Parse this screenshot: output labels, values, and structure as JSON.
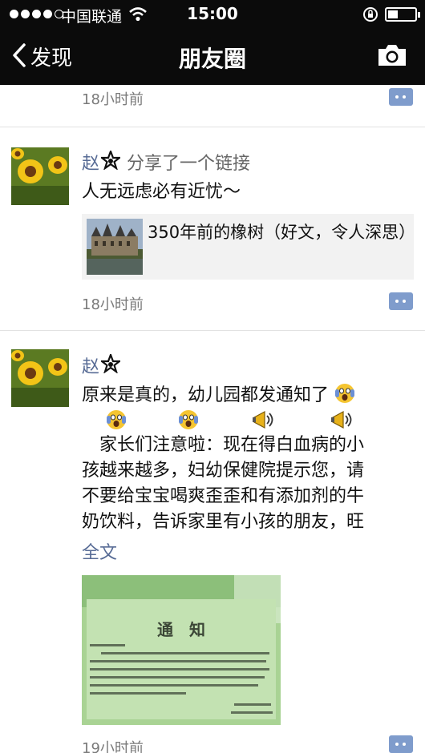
{
  "status_bar": {
    "carrier": "中国联通",
    "time": "15:00"
  },
  "nav": {
    "back_label": "发现",
    "title": "朋友圈"
  },
  "feed": {
    "top_post_time": "18小时前",
    "posts": [
      {
        "author": "赵",
        "action": "分享了一个链接",
        "text": "人无远虑必有近忧～",
        "link_title": "350年前的橡树（好文，令人深思）",
        "time": "18小时前"
      },
      {
        "author": "赵",
        "text_line1": "原来是真的，幼儿园都发通知了",
        "text_line3": "　家长们注意啦：现在得白血病的小",
        "text_line4": "孩越来越多，妇幼保健院提示您，请",
        "text_line5": "不要给宝宝喝爽歪歪和有添加剂的牛",
        "text_line6": "奶饮料，告诉家里有小孩的朋友，旺",
        "full_text_link": "全文",
        "image_heading": "通　知",
        "time": "19小时前"
      }
    ]
  },
  "colors": {
    "nav_background": "#0b0b0b",
    "name_blue": "#576b95",
    "time_gray": "#7a7a7a",
    "comment_button": "#7f9ccc"
  },
  "icons": [
    "back-chevron-icon",
    "camera-icon",
    "wifi-icon",
    "lock-rotation-icon",
    "battery-icon",
    "comment-icon",
    "scream-emoji-icon",
    "megaphone-emoji-icon",
    "star-badge-icon"
  ]
}
